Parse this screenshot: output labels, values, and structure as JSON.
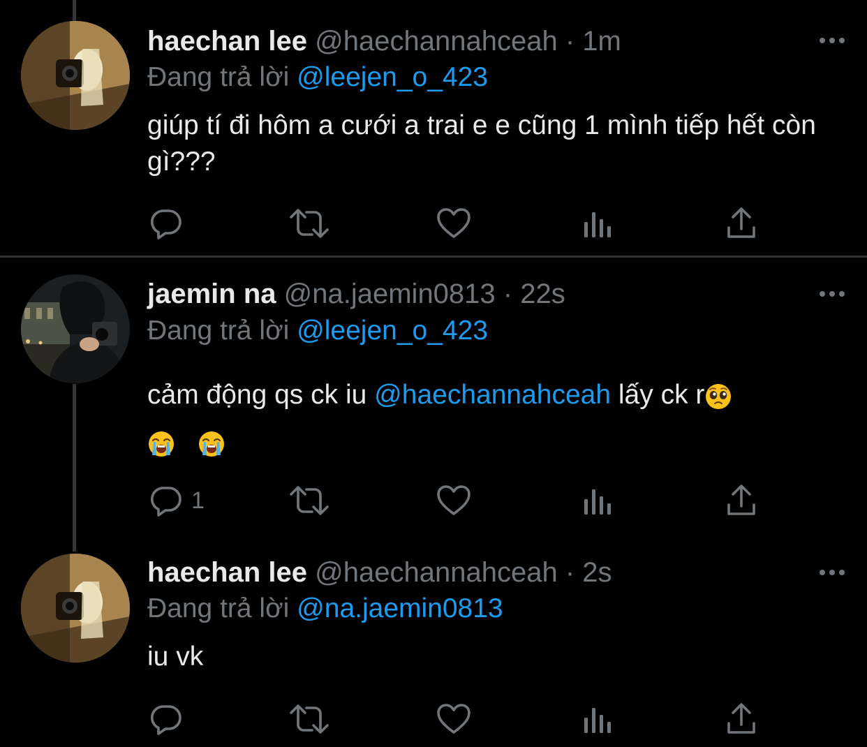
{
  "colors": {
    "background": "#000000",
    "text": "#e7e9ea",
    "muted": "#71767b",
    "accent": "#1d9bf0",
    "thread_line": "#333639"
  },
  "tweets": [
    {
      "name": "haechan lee",
      "handle": "@haechannahceah",
      "separator": "·",
      "time": "1m",
      "replying_prefix": "Đang trả lời",
      "replying_to": "@leejen_o_423",
      "text": "giúp tí đi hôm a cưới a trai e e cũng 1 mình tiếp hết còn gì???",
      "reply_count": "",
      "avatar_icon": "avatar-haechan",
      "more_icon": "more-horizontal-icon"
    },
    {
      "name": "jaemin na",
      "handle": "@na.jaemin0813",
      "separator": "·",
      "time": "22s",
      "replying_prefix": "Đang trả lời",
      "replying_to": "@leejen_o_423",
      "text_before": "cảm động qs ck iu ",
      "text_mention": "@haechannahceah",
      "text_after": " lấy ck r",
      "emojis": [
        "pleading-face",
        "loudly-crying-face",
        "loudly-crying-face"
      ],
      "reply_count": "1",
      "avatar_icon": "avatar-jaemin",
      "more_icon": "more-horizontal-icon"
    },
    {
      "name": "haechan lee",
      "handle": "@haechannahceah",
      "separator": "·",
      "time": "2s",
      "replying_prefix": "Đang trả lời",
      "replying_to": "@na.jaemin0813",
      "text": "iu vk",
      "reply_count": "",
      "avatar_icon": "avatar-haechan",
      "more_icon": "more-horizontal-icon"
    }
  ],
  "action_icons": [
    "reply-icon",
    "retweet-icon",
    "like-icon",
    "analytics-icon",
    "share-icon"
  ]
}
